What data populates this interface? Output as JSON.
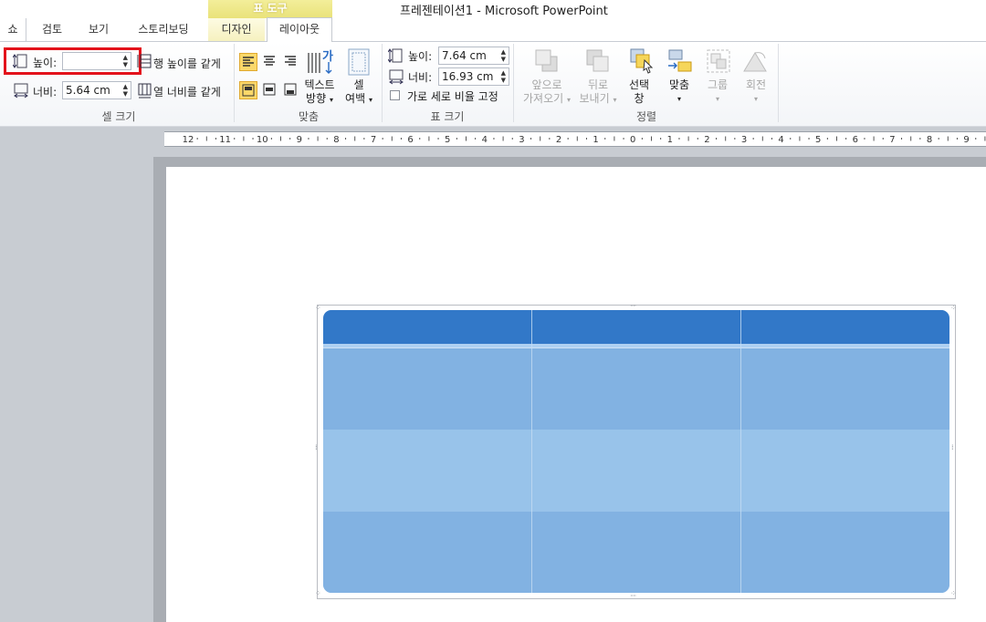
{
  "window": {
    "title": "프레젠테이션1  -  Microsoft PowerPoint"
  },
  "context_tab_group": "표 도구",
  "tabs": [
    "쇼",
    "검토",
    "보기",
    "스토리보딩",
    "디자인",
    "레이아웃"
  ],
  "active_tab": "레이아웃",
  "cell_size": {
    "height_label": "높이:",
    "height_value": "",
    "width_label": "너비:",
    "width_value": "5.64 cm",
    "distribute_rows": "행 높이를 같게",
    "distribute_cols": "열 너비를 같게",
    "group_label": "셀 크기"
  },
  "alignment": {
    "text_direction_line1": "텍스트",
    "text_direction_line2": "방향",
    "cell_margins_line1": "셀",
    "cell_margins_line2": "여백",
    "group_label": "맞춤"
  },
  "table_size": {
    "height_label": "높이:",
    "height_value": "7.64 cm",
    "width_label": "너비:",
    "width_value": "16.93 cm",
    "lock_ratio_label": "가로 세로 비율 고정",
    "lock_ratio_checked": false,
    "group_label": "표 크기"
  },
  "arrange": {
    "bring_forward_line1": "앞으로",
    "bring_forward_line2": "가져오기",
    "send_backward_line1": "뒤로",
    "send_backward_line2": "보내기",
    "selection_pane_line1": "선택",
    "selection_pane_line2": "창",
    "align": "맞춤",
    "group": "그룹",
    "rotate": "회전",
    "group_label": "정렬"
  },
  "ruler": {
    "labels": [
      "12",
      "11",
      "10",
      "9",
      "8",
      "7",
      "6",
      "5",
      "4",
      "3",
      "2",
      "1",
      "0",
      "1",
      "2",
      "3",
      "4",
      "5",
      "6",
      "7",
      "8",
      "9"
    ]
  },
  "colors": {
    "header_row": "#3278c8",
    "band_dark": "#82b2e2",
    "band_light": "#98c3ea",
    "highlight": "#e3121b"
  },
  "table": {
    "rows": 4,
    "cols": 3
  }
}
